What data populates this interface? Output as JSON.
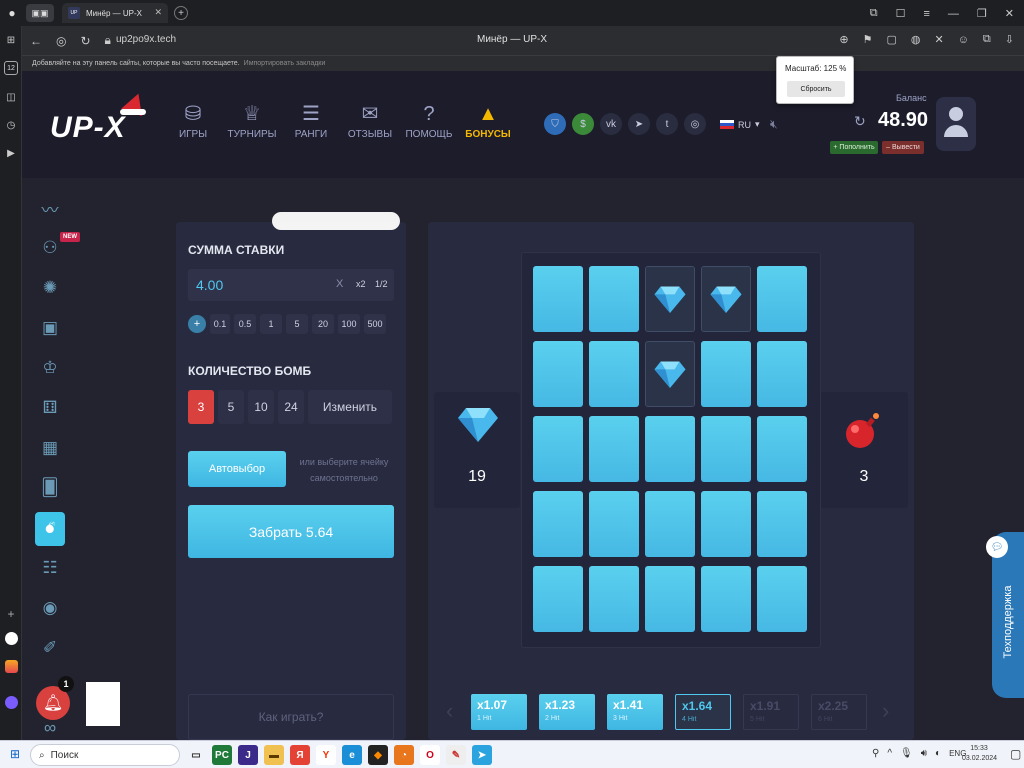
{
  "browser": {
    "tab_title": "Минёр — UP-X",
    "window_title": "Минёр — UP-X",
    "address": "up2po9x.tech",
    "bookmarks_hint": "Добавляйте на эту панель сайты, которые вы часто посещаете.",
    "bookmarks_import": "Импортировать закладки",
    "sidebar_badge": "12",
    "zoom_label": "Масштаб: 125 %",
    "zoom_reset": "Сбросить"
  },
  "site": {
    "logo": "UP-X",
    "nav": [
      {
        "label": "ИГРЫ",
        "icon": "game-icon"
      },
      {
        "label": "ТУРНИРЫ",
        "icon": "trophy-icon"
      },
      {
        "label": "РАНГИ",
        "icon": "rank-icon"
      },
      {
        "label": "ОТЗЫВЫ",
        "icon": "reviews-icon"
      },
      {
        "label": "ПОМОЩЬ",
        "icon": "help-icon"
      },
      {
        "label": "БОНУСЫ",
        "icon": "bonus-icon"
      }
    ],
    "lang": "RU",
    "balance_label": "Баланс",
    "balance": "48.90",
    "deposit": "+ Пополнить",
    "withdraw": "– Вывести",
    "new_badge": "NEW"
  },
  "bet": {
    "title": "СУММА СТАВКИ",
    "value": "4.00",
    "clear": "X",
    "double": "x2",
    "half": "1/2",
    "plus": "+",
    "quick": [
      "0.1",
      "0.5",
      "1",
      "5",
      "20",
      "100",
      "500"
    ]
  },
  "bombs": {
    "title": "КОЛИЧЕСТВО БОМБ",
    "options": [
      "3",
      "5",
      "10",
      "24"
    ],
    "change": "Изменить"
  },
  "auto": {
    "button": "Автовыбор",
    "hint": "или выберите ячейку самостоятельно"
  },
  "cashout": "Забрать 5.64",
  "how_to": "Как играть?",
  "stats": {
    "gems": "19",
    "bombs": "3"
  },
  "grid": {
    "rows": 5,
    "cols": 5,
    "revealed_gems": [
      2,
      3,
      7
    ]
  },
  "multipliers": [
    {
      "value": "x1.07",
      "hits": "1 Hit",
      "state": "done"
    },
    {
      "value": "x1.23",
      "hits": "2 Hit",
      "state": "done"
    },
    {
      "value": "x1.41",
      "hits": "3 Hit",
      "state": "done"
    },
    {
      "value": "x1.64",
      "hits": "4 Hit",
      "state": "current"
    },
    {
      "value": "x1.91",
      "hits": "5 Hit",
      "state": "future"
    },
    {
      "value": "x2.25",
      "hits": "6 Hit",
      "state": "future"
    }
  ],
  "support": "Техподдержка",
  "notifications": "1",
  "taskbar": {
    "search": "Поиск",
    "lang": "ENG",
    "time": "15:33",
    "date": "03.02.2024"
  },
  "colors": {
    "accent": "#4fc7ee",
    "bomb_selected": "#d9413f",
    "bonus": "#f5b800"
  }
}
